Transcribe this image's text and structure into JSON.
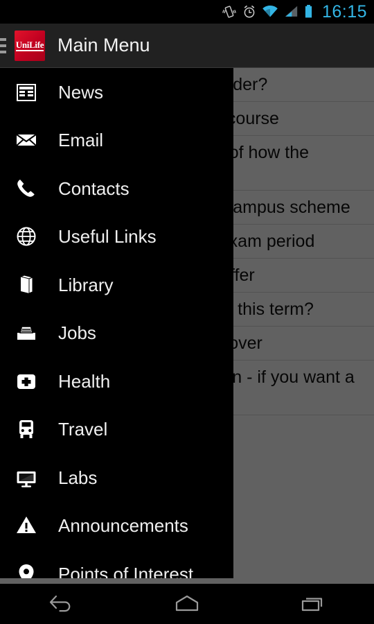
{
  "status_bar": {
    "time": "16:15",
    "accent_color": "#33b5e5",
    "icons": [
      "vibrate-icon",
      "alarm-icon",
      "wifi-icon",
      "signal-icon",
      "battery-icon"
    ]
  },
  "action_bar": {
    "title": "Main Menu",
    "logo_text": "UniLife",
    "logo_color": "#c00020",
    "background": "#212121"
  },
  "drawer": {
    "background": "#000000",
    "items": [
      {
        "label": "News",
        "icon": "newspaper-icon"
      },
      {
        "label": "Email",
        "icon": "envelope-icon"
      },
      {
        "label": "Contacts",
        "icon": "phone-icon"
      },
      {
        "label": "Useful Links",
        "icon": "globe-icon"
      },
      {
        "label": "Library",
        "icon": "book-icon"
      },
      {
        "label": "Jobs",
        "icon": "briefcase-icon"
      },
      {
        "label": "Health",
        "icon": "medical-cross-icon"
      },
      {
        "label": "Travel",
        "icon": "bus-icon"
      },
      {
        "label": "Labs",
        "icon": "monitor-icon"
      },
      {
        "label": "Announcements",
        "icon": "warning-triangle-icon"
      },
      {
        "label": "Points of Interest",
        "icon": "map-pin-icon"
      }
    ]
  },
  "content": {
    "scrim_opacity": 0.62,
    "rows": [
      {
        "text": "Do you have an Eating Disorder?"
      },
      {
        "text": "Funding for a Postgraduate course"
      },
      {
        "text": "Breakthrough in recognition of how the human body works"
      },
      {
        "text": "Students help out with new campus scheme"
      },
      {
        "text": "Library hours extended for exam period"
      },
      {
        "text": "Sports centre membership offer"
      },
      {
        "text": "Who will be looking after you this term?"
      },
      {
        "text": "Student Union Culture: Takeover"
      },
      {
        "text": "Tickets going fast - book soon - if you want a place you must hurry!"
      }
    ]
  },
  "nav_bar": {
    "buttons": [
      {
        "name": "back-button",
        "icon": "back-arrow-icon"
      },
      {
        "name": "home-button",
        "icon": "home-icon"
      },
      {
        "name": "recents-button",
        "icon": "recents-icon"
      }
    ]
  }
}
